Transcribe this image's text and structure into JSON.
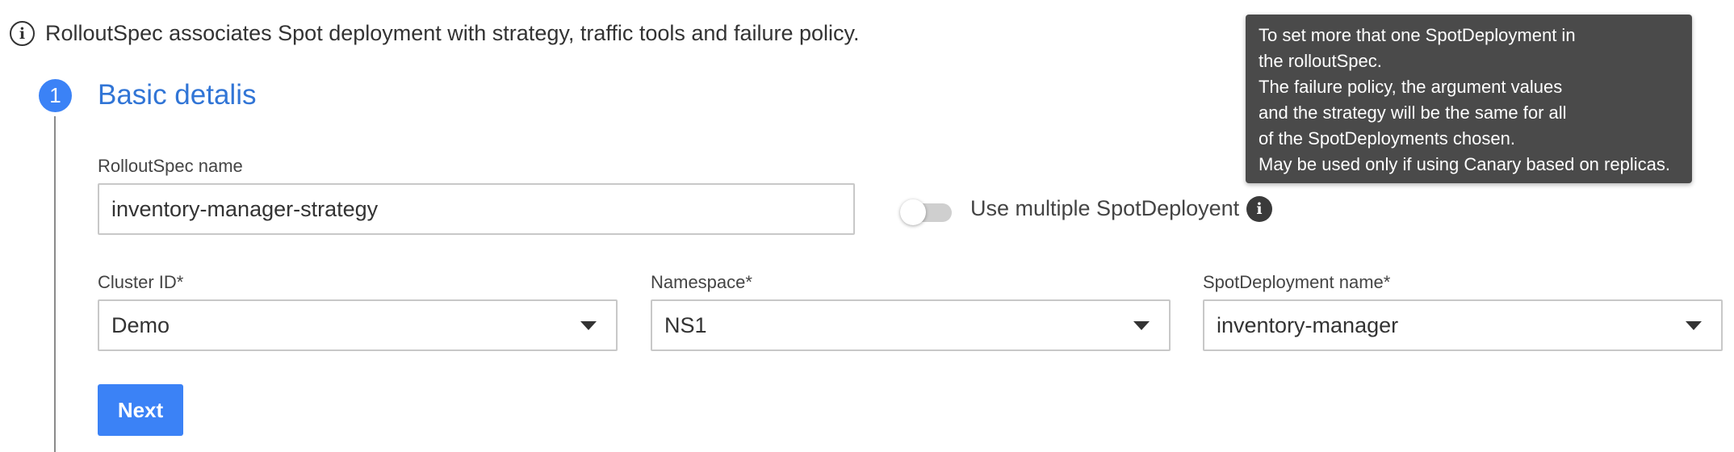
{
  "info": {
    "icon": "info-icon",
    "text": "RolloutSpec associates Spot deployment with strategy, traffic tools and failure policy."
  },
  "step": {
    "number": "1",
    "title": "Basic detalis"
  },
  "form": {
    "rollout_name": {
      "label": "RolloutSpec name",
      "value": "inventory-manager-strategy"
    },
    "multiple_toggle": {
      "label": "Use multiple SpotDeployent",
      "checked": false,
      "info_icon": "info-icon"
    },
    "cluster": {
      "label": "Cluster ID*",
      "value": "Demo"
    },
    "namespace": {
      "label": "Namespace*",
      "value": "NS1"
    },
    "spot_deployment": {
      "label": "SpotDeployment name*",
      "value": "inventory-manager"
    },
    "next_label": "Next"
  },
  "tooltip": {
    "lines": [
      "To set more that one SpotDeployment in",
      "the rolloutSpec.",
      "The failure policy, the argument values",
      "and the strategy will be the same for all",
      "of the SpotDeployments chosen.",
      "May be used only if using Canary based on replicas."
    ]
  },
  "colors": {
    "accent": "#3b82f6",
    "title": "#3175d6",
    "tooltip_bg": "#4a4a4a"
  }
}
